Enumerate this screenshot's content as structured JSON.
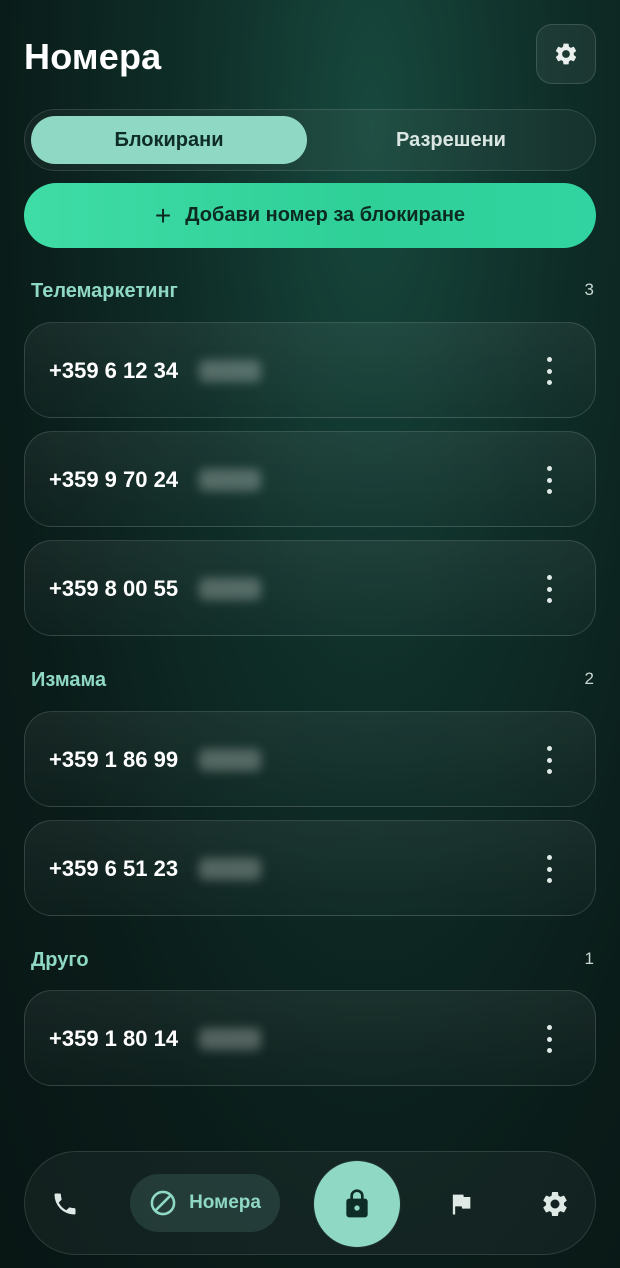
{
  "header": {
    "title": "Номера",
    "settings_icon": "gear-icon"
  },
  "segmented": {
    "tabs": [
      {
        "label": "Блокирани",
        "active": true
      },
      {
        "label": "Разрешени",
        "active": false
      }
    ]
  },
  "add_button": {
    "icon": "plus-icon",
    "label": "Добави номер за блокиране"
  },
  "sections": [
    {
      "title": "Телемаркетинг",
      "count": "3",
      "numbers": [
        "+359 6 12 34",
        "+359 9 70 24",
        "+359 8 00 55"
      ]
    },
    {
      "title": "Измама",
      "count": "2",
      "numbers": [
        "+359 1 86 99",
        "+359 6 51 23"
      ]
    },
    {
      "title": "Друго",
      "count": "1",
      "numbers": [
        "+359 1 80 14"
      ]
    }
  ],
  "bottom_nav": {
    "items": [
      {
        "icon": "phone-icon"
      },
      {
        "icon": "block-icon",
        "label": "Номера",
        "active": true
      },
      {
        "icon": "lock-icon"
      },
      {
        "icon": "flag-icon"
      },
      {
        "icon": "gear-icon"
      }
    ]
  },
  "colors": {
    "accent": "#8fd8c3",
    "add_button": "#36d6a0",
    "background": "#0d2621"
  }
}
